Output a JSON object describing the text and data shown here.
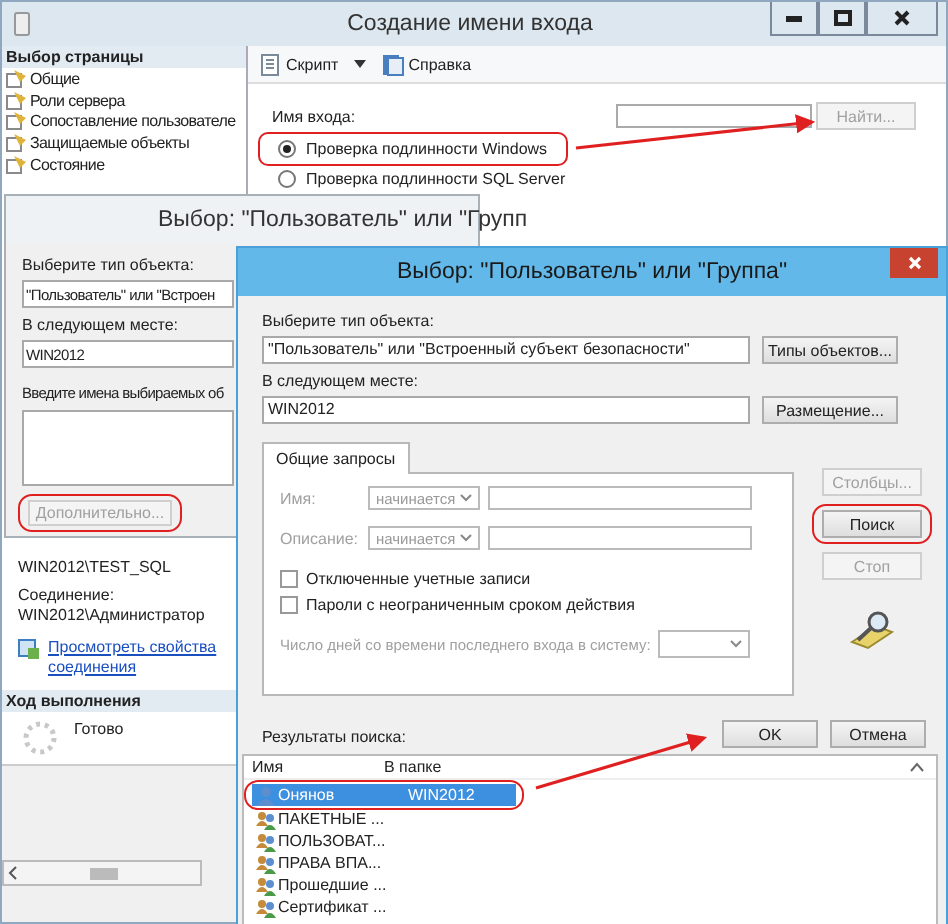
{
  "main_window": {
    "title": "Создание имени входа"
  },
  "sidebar": {
    "header": "Выбор страницы",
    "items": [
      {
        "label": "Общие"
      },
      {
        "label": "Роли сервера"
      },
      {
        "label": "Сопоставление пользователе"
      },
      {
        "label": "Защищаемые объекты"
      },
      {
        "label": "Состояние"
      }
    ]
  },
  "connection": {
    "server": "WIN2012\\TEST_SQL",
    "label": "Соединение:",
    "user": "WIN2012\\Администратор",
    "link": "Просмотреть свойства соединения"
  },
  "progress": {
    "header": "Ход выполнения",
    "status": "Готово"
  },
  "toolbar": [
    {
      "label": "Скрипт",
      "kind": "script"
    },
    {
      "label": "Справка",
      "kind": "help"
    }
  ],
  "login": {
    "label": "Имя входа:",
    "find_button": {
      "label": "Найти...",
      "disabled": true
    },
    "auth_options": [
      {
        "label": "Проверка подлинности Windows",
        "selected": true
      },
      {
        "label": "Проверка подлинности SQL Server",
        "selected": false
      }
    ]
  },
  "back_dialog": {
    "title": "Выбор: \"Пользователь\" или \"Групп",
    "object_type_label": "Выберите тип объекта:",
    "object_type": "\"Пользователь\" или \"Встроен",
    "location_label": "В следующем месте:",
    "location": "WIN2012",
    "names_label": "Введите имена выбираемых об",
    "advanced_button": {
      "label": "Дополнительно...",
      "disabled": true
    }
  },
  "front_dialog": {
    "title": "Выбор: \"Пользователь\" или \"Группа\"",
    "object_type_label": "Выберите тип объекта:",
    "object_type": "\"Пользователь\" или \"Встроенный субъект безопасности\"",
    "object_types_button": "Типы объектов...",
    "location_label": "В следующем месте:",
    "location": "WIN2012",
    "location_button": "Размещение...",
    "tab": {
      "label": "Общие запросы",
      "selected": true
    },
    "queries": [
      {
        "label": "Имя:",
        "operator": "начинается"
      },
      {
        "label": "Описание:",
        "operator": "начинается"
      }
    ],
    "checkboxes": [
      {
        "label": "Отключенные учетные записи",
        "checked": false
      },
      {
        "label": "Пароли с неограниченным сроком действия",
        "checked": false
      }
    ],
    "days_label": "Число дней со времени последнего входа в систему:",
    "side_buttons": [
      {
        "label": "Столбцы...",
        "disabled": true
      },
      {
        "label": "Поиск",
        "disabled": false
      },
      {
        "label": "Стоп",
        "disabled": true
      }
    ],
    "ok_button": "OK",
    "cancel_button": "Отмена",
    "results_label": "Результаты поиска:",
    "results": {
      "columns": [
        "Имя",
        "В папке"
      ],
      "rows": [
        {
          "name": "Онянов",
          "folder": "WIN2012",
          "selected": true,
          "kind": "user"
        },
        {
          "name": "ПАКЕТНЫЕ ...",
          "selected": false,
          "kind": "group"
        },
        {
          "name": "ПОЛЬЗОВАТ...",
          "selected": false,
          "kind": "group"
        },
        {
          "name": "ПРАВА ВПА...",
          "selected": false,
          "kind": "group"
        },
        {
          "name": "Прошедшие ...",
          "selected": false,
          "kind": "group"
        },
        {
          "name": "Сертификат ...",
          "selected": false,
          "kind": "group"
        }
      ]
    }
  }
}
